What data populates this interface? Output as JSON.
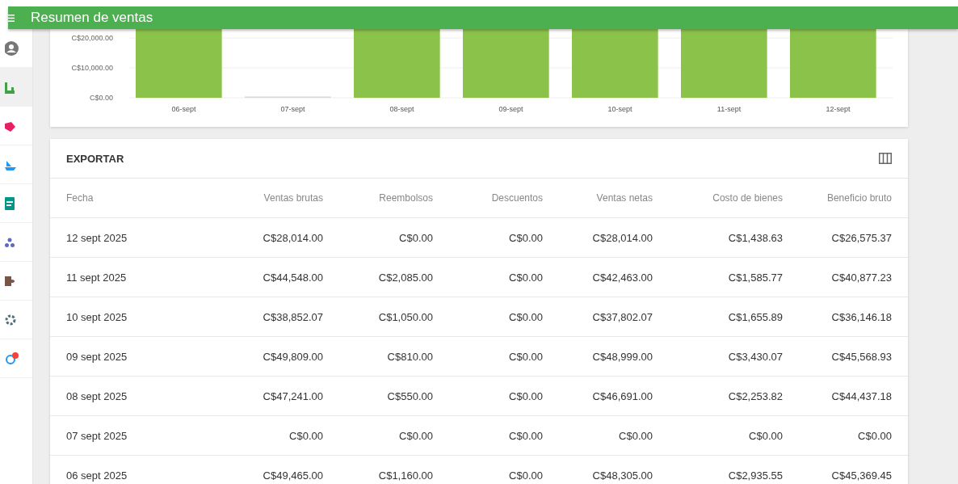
{
  "header": {
    "title": "Resumen de ventas"
  },
  "sidebar": {
    "items": [
      {
        "kind": "user",
        "selected": false
      },
      {
        "kind": "chart",
        "selected": true
      },
      {
        "kind": "tag",
        "selected": false
      },
      {
        "kind": "boat",
        "selected": false
      },
      {
        "kind": "document",
        "selected": false
      },
      {
        "kind": "people",
        "selected": false
      },
      {
        "kind": "puzzle",
        "selected": false
      },
      {
        "kind": "gear",
        "selected": false
      },
      {
        "kind": "app",
        "selected": false
      }
    ]
  },
  "chart": {
    "y_labels": [
      "C$20,000.00",
      "C$10,000.00",
      "C$0.00"
    ],
    "bars": [
      {
        "label": "06-sept",
        "empty": false
      },
      {
        "label": "07-sept",
        "empty": true
      },
      {
        "label": "08-sept",
        "empty": false
      },
      {
        "label": "09-sept",
        "empty": false
      },
      {
        "label": "10-sept",
        "empty": false
      },
      {
        "label": "11-sept",
        "empty": false
      },
      {
        "label": "12-sept",
        "empty": false
      }
    ]
  },
  "table": {
    "export_label": "EXPORTAR",
    "columns": [
      "Fecha",
      "Ventas brutas",
      "Reembolsos",
      "Descuentos",
      "Ventas netas",
      "Costo de bienes",
      "Beneficio bruto"
    ],
    "rows": [
      [
        "12 sept 2025",
        "C$28,014.00",
        "C$0.00",
        "C$0.00",
        "C$28,014.00",
        "C$1,438.63",
        "C$26,575.37"
      ],
      [
        "11 sept 2025",
        "C$44,548.00",
        "C$2,085.00",
        "C$0.00",
        "C$42,463.00",
        "C$1,585.77",
        "C$40,877.23"
      ],
      [
        "10 sept 2025",
        "C$38,852.07",
        "C$1,050.00",
        "C$0.00",
        "C$37,802.07",
        "C$1,655.89",
        "C$36,146.18"
      ],
      [
        "09 sept 2025",
        "C$49,809.00",
        "C$810.00",
        "C$0.00",
        "C$48,999.00",
        "C$3,430.07",
        "C$45,568.93"
      ],
      [
        "08 sept 2025",
        "C$47,241.00",
        "C$550.00",
        "C$0.00",
        "C$46,691.00",
        "C$2,253.82",
        "C$44,437.18"
      ],
      [
        "07 sept 2025",
        "C$0.00",
        "C$0.00",
        "C$0.00",
        "C$0.00",
        "C$0.00",
        "C$0.00"
      ],
      [
        "06 sept 2025",
        "C$49,465.00",
        "C$1,160.00",
        "C$0.00",
        "C$48,305.00",
        "C$2,935.55",
        "C$45,369.45"
      ]
    ]
  }
}
